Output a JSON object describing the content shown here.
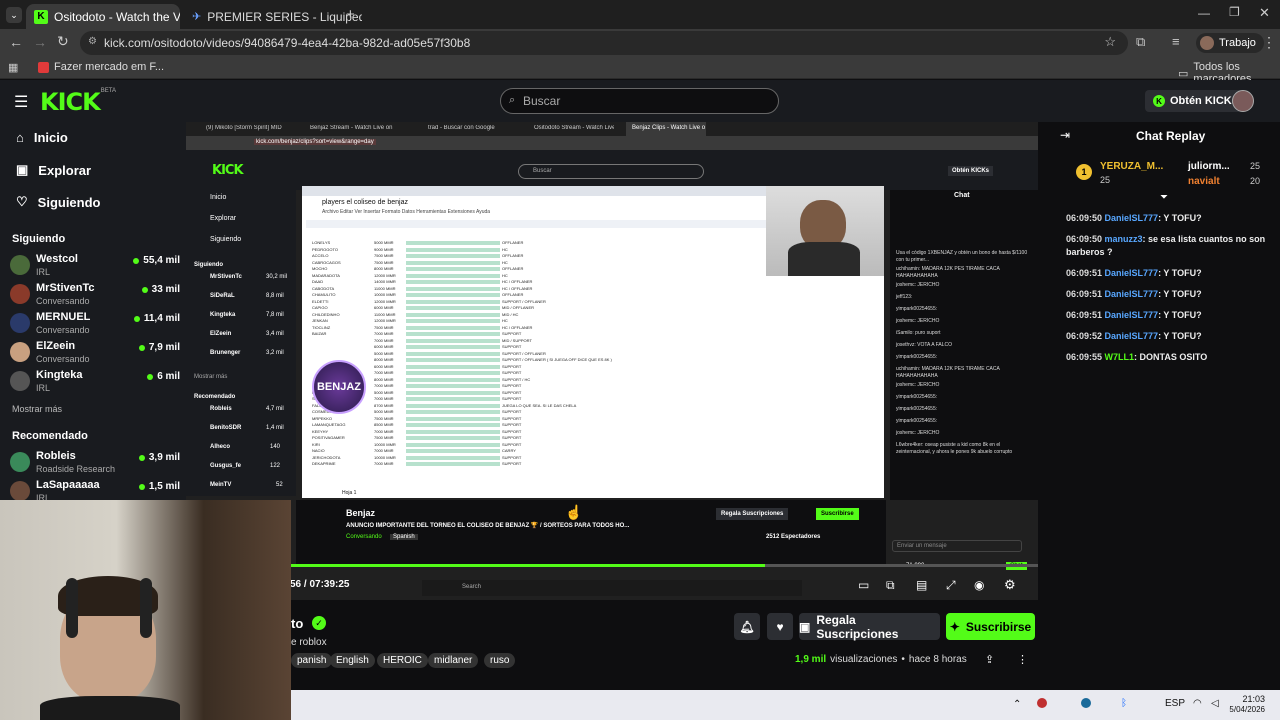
{
  "browser": {
    "tabs": [
      {
        "label": "Ositodoto - Watch the VOD on",
        "active": true
      },
      {
        "label": "PREMIER SERIES - Liquipedia D",
        "active": false
      }
    ],
    "url": "kick.com/ositodoto/videos/94086479-4ea4-42ba-982d-ad05e57f30b8",
    "profile": "Trabajo",
    "bookmark": "Fazer mercado em F...",
    "all_bookmarks": "Todos los marcadores"
  },
  "header": {
    "logo": "KICK",
    "logo_beta": "BETA",
    "search_placeholder": "Buscar",
    "kicks_button": "Obtén KICKs"
  },
  "sidebar": {
    "nav": [
      {
        "label": "Inicio",
        "icon": "home-icon"
      },
      {
        "label": "Explorar",
        "icon": "compass-icon"
      },
      {
        "label": "Siguiendo",
        "icon": "heart-icon"
      }
    ],
    "following_title": "Siguiendo",
    "following": [
      {
        "name": "Westcol",
        "sub": "IRL",
        "viewers": "55,4 mil",
        "color": "#4a6a3a"
      },
      {
        "name": "MrStivenTc",
        "sub": "Conversando",
        "viewers": "33 mil",
        "color": "#8a3a2a"
      },
      {
        "name": "MERNUEL",
        "sub": "Conversando",
        "viewers": "11,4 mil",
        "color": "#2a3a6a"
      },
      {
        "name": "ElZeein",
        "sub": "Conversando",
        "viewers": "7,9 mil",
        "color": "#c8a080"
      },
      {
        "name": "Kingteka",
        "sub": "IRL",
        "viewers": "6 mil",
        "color": "#555"
      }
    ],
    "show_more": "Mostrar más",
    "recommended_title": "Recomendado",
    "recommended": [
      {
        "name": "Robleis",
        "sub": "Roadside Research",
        "viewers": "3,9 mil",
        "color": "#3a8a5a"
      },
      {
        "name": "LaSapaaaaa",
        "sub": "IRL",
        "viewers": "1,5 mil",
        "color": "#6a4a3a"
      }
    ]
  },
  "player": {
    "time": "56 / 07:39:25"
  },
  "inner": {
    "tabs": [
      "(9) Mikoto [Storm Spirit] MID",
      "Benjaz Stream - Watch Live on",
      "trad - Buscar con Google",
      "Ositodoto Stream - Watch Live",
      "Benjaz Clips - Watch Live o"
    ],
    "url": "kick.com/benjaz/clips?sort=view&range=day",
    "search": "Buscar",
    "kicks": "Obtén KICKs",
    "nav": [
      "Inicio",
      "Explorar",
      "Siguiendo"
    ],
    "following_title": "Siguiendo",
    "following": [
      {
        "name": "MrStivenTc",
        "sub": "Kings League",
        "viewers": "30,2 mil"
      },
      {
        "name": "SiDeRaL",
        "sub": "IRL",
        "viewers": "8,8 mil"
      },
      {
        "name": "Kingteka",
        "sub": "IRL",
        "viewers": "7,8 mil"
      },
      {
        "name": "ElZeein",
        "sub": "Conversando",
        "viewers": "3,4 mil"
      },
      {
        "name": "Brunenger",
        "sub": "IRL",
        "viewers": "3,2 mil"
      }
    ],
    "show_more": "Mostrar más",
    "recommended_title": "Recomendado",
    "recommended": [
      {
        "name": "Robleis",
        "sub": "Roadside Research",
        "viewers": "4,7 mil"
      },
      {
        "name": "BenitoSDR",
        "sub": "Conversando",
        "viewers": "1,4 mil"
      },
      {
        "name": "Alheco",
        "sub": "Grand Theft Auto V",
        "viewers": "140"
      },
      {
        "name": "Gusgus_fe",
        "sub": "Slots & Casino",
        "viewers": "122"
      },
      {
        "name": "MeinTV",
        "sub": "",
        "viewers": "52"
      }
    ],
    "sheet_title": "players el coliseo de benjaz",
    "sheet_menu": "Archivo  Editar  Ver  Insertar  Formato  Datos  Herramientas  Extensiones  Ayuda",
    "sheet_rows": [
      [
        "LONELYS",
        "5000 MMR",
        "OFFLANER"
      ],
      [
        "PEDROGOTO",
        "9000 MMR",
        "HC"
      ],
      [
        "ACCELO",
        "7500 MMR",
        "OFFLANER"
      ],
      [
        "CABROCAGOS",
        "7500 MMR",
        "HC"
      ],
      [
        "MOCHO",
        "8000 MMR",
        "OFFLANER"
      ],
      [
        "MADARADOTA",
        "12000 MMR",
        "HC"
      ],
      [
        "DAAD",
        "14000 MMR",
        "HC / OFFLANER"
      ],
      [
        "CABODOTA",
        "11000 MMR",
        "HC / OFFLANER"
      ],
      [
        "CHAMULITO",
        "10000 MMR",
        "OFFLANER"
      ],
      [
        "ELDETTI",
        "12000 MMR",
        "SUPPORT / OFFLANER"
      ],
      [
        "CAPIGO",
        "6000 MMR",
        "MID / OFFLANER"
      ],
      [
        "CHILDEDINHO",
        "11000 MMR",
        "MID / HC"
      ],
      [
        "JENKAN",
        "12000 MMR",
        "HC"
      ],
      [
        "TIOCLINZ",
        "7500 MMR",
        "HC / OFFLANER"
      ],
      [
        "BAIZAR",
        "7000 MMR",
        "SUPPORT"
      ],
      [
        "",
        "7000 MMR",
        "MID / SUPPORT"
      ],
      [
        "",
        "6000 MMR",
        "SUPPORT"
      ],
      [
        "",
        "5000 MMR",
        "SUPPORT / OFFLANER"
      ],
      [
        "",
        "8000 MMR",
        "SUPPORT / OFFLANER ( SI JUEGA OFF DICE QUE ES 8K )"
      ],
      [
        "",
        "6000 MMR",
        "SUPPORT"
      ],
      [
        "",
        "7000 MMR",
        "SUPPORT"
      ],
      [
        "",
        "8000 MMR",
        "SUPPORT / HC"
      ],
      [
        "",
        "7000 MMR",
        "SUPPORT"
      ],
      [
        "KDD",
        "5000 MMR",
        "SUPPORT"
      ],
      [
        "SOE21",
        "7000 MMR",
        "SUPPORT"
      ],
      [
        "FALCOSTYLE",
        "8700 MMR",
        "JUEGA LO QUE SEA. SI LE DAS CHELA"
      ],
      [
        "COSMECITO",
        "5000 MMR",
        "SUPPORT"
      ],
      [
        "MRPEKKO",
        "7500 MMR",
        "SUPPORT"
      ],
      [
        "LAMANQUETAGG",
        "8500 MMR",
        "SUPPORT"
      ],
      [
        "KEEYHY",
        "7000 MMR",
        "SUPPORT"
      ],
      [
        "POSITIVAGAMER",
        "7500 MMR",
        "SUPPORT"
      ],
      [
        "KIRI",
        "10000 MMR",
        "SUPPORT"
      ],
      [
        "NACIO",
        "7000 MMR",
        "CARRY"
      ],
      [
        "JERICHODOTA",
        "10000 MMR",
        "SUPPORT"
      ],
      [
        "DEKAPRIME",
        "7000 MMR",
        "SUPPORT"
      ]
    ],
    "sheet_tab": "Hoja 1",
    "streamer": "Benjaz",
    "stream_title": "ANUNCIO IMPORTANTE DEL TORNEO EL COLISEO DE BENJAZ 🏆 / SORTEOS PARA TODOS HO...",
    "category": "Conversando",
    "language": "Spanish",
    "gift_label": "Regala Suscripciones",
    "sub_label": "Suscribirse",
    "viewers": "2512 Espectadores",
    "chat_title": "Chat",
    "chat_input": "Enviar un mensaje",
    "chat_button": "Chat",
    "bottom_count": "71.090",
    "chat_msgs": [
      "Usa el código 1XBENJAZ y obtén un bono de hasta $/1100 con tu primer...",
      "uchihamin: MADARA 12K PES TIRAME CACA HAHAHAHAHAHA",
      "joshemc: JERICHO",
      "jeff123:",
      "yimpark00254655:",
      "joshemc: JERICHO",
      "iSamilo: puro suport",
      "josethvz: VOTA A FALCO",
      "yimpark00254655:",
      "uchihamin: MADARA 12K PES TIRAME CACA HAHAHAHAHAHA",
      "joshemc: JERICHO",
      "yimpark00254655:",
      "yimpark00254655:",
      "yimpark00254655:",
      "joshemc: JERICHO",
      "L6wbre4ker: oseap pusiste a kid como 8k en el zeinternacional, y ahora le pones 9k abuelo corrupto"
    ],
    "taskbar_search": "Search"
  },
  "chat": {
    "title": "Chat Replay",
    "leaders": [
      {
        "name": "YERUZA_M...",
        "count": "25"
      },
      {
        "name": "juliorm...",
        "count": "25"
      },
      {
        "name": "navialt",
        "count": "20"
      }
    ],
    "leader_rank": "1",
    "messages": [
      {
        "time": "06:09:50",
        "user": "DanielSL777",
        "text": ": Y TOFU?"
      },
      {
        "time": "06:09:50",
        "user": "manuzz3",
        "text": ": se esa lista cuantos no son barberos ?"
      },
      {
        "time": "06:09:51",
        "user": "DanielSL777",
        "text": ": Y TOFU?"
      },
      {
        "time": "06:09:51",
        "user": "DanielSL777",
        "text": ": Y TOFU?"
      },
      {
        "time": "06:09:51",
        "user": "DanielSL777",
        "text": ": Y TOFU?"
      },
      {
        "time": "06:09:52",
        "user": "DanielSL777",
        "text": ": Y TOFU?"
      },
      {
        "time": "06:09:55",
        "user": "W7LL1",
        "text": ": DONTAS OSITO"
      }
    ]
  },
  "video_info": {
    "title_fragment": "to",
    "category_fragment": "e roblox",
    "tags": [
      "panish",
      "English",
      "HEROIC",
      "midlaner",
      "ruso"
    ],
    "gift_label": "Regala Suscripciones",
    "sub_label": "Suscribirse",
    "views": "1,9 mil",
    "views_label": "visualizaciones",
    "ago": "hace 8 horas"
  },
  "taskbar": {
    "lang": "ESP",
    "lang2": "PTB",
    "time": "21:03",
    "date": "5/04/2026"
  },
  "colors": {
    "accent": "#53fc18",
    "bg": "#0e0e10",
    "panel": "#191b1f"
  }
}
